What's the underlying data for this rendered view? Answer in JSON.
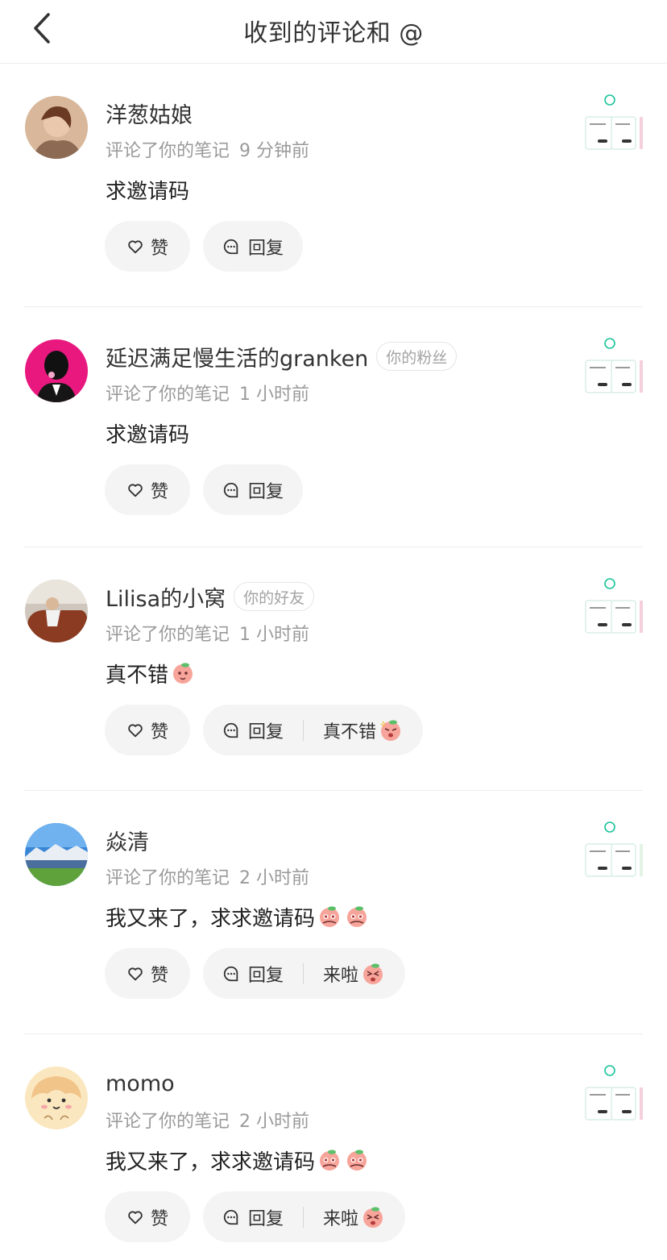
{
  "header": {
    "title": "收到的评论和 @"
  },
  "notifications": [
    {
      "name": "洋葱姑娘",
      "tag": "",
      "action": "评论了你的笔记",
      "time": "9 分钟前",
      "comment": "求邀请码",
      "comment_emojis": [],
      "like_label": "赞",
      "reply_label": "回复",
      "quick_reply": "",
      "quick_reply_emoji": ""
    },
    {
      "name": "延迟满足慢生活的granken",
      "tag": "你的粉丝",
      "action": "评论了你的笔记",
      "time": "1 小时前",
      "comment": "求邀请码",
      "comment_emojis": [],
      "like_label": "赞",
      "reply_label": "回复",
      "quick_reply": "",
      "quick_reply_emoji": ""
    },
    {
      "name": "Lilisa的小窝",
      "tag": "你的好友",
      "action": "评论了你的笔记",
      "time": "1 小时前",
      "comment": "真不错",
      "comment_emojis": [
        "peach-emoji"
      ],
      "like_label": "赞",
      "reply_label": "回复",
      "quick_reply": "真不错",
      "quick_reply_emoji": "peach-emoji"
    },
    {
      "name": "焱清",
      "tag": "",
      "action": "评论了你的笔记",
      "time": "2 小时前",
      "comment": "我又来了，求求邀请码",
      "comment_emojis": [
        "peach-emoji",
        "peach-emoji"
      ],
      "like_label": "赞",
      "reply_label": "回复",
      "quick_reply": "来啦",
      "quick_reply_emoji": "peach-emoji"
    },
    {
      "name": "momo",
      "tag": "",
      "action": "评论了你的笔记",
      "time": "2 小时前",
      "comment": "我又来了，求求邀请码",
      "comment_emojis": [
        "peach-emoji",
        "peach-emoji"
      ],
      "like_label": "赞",
      "reply_label": "回复",
      "quick_reply": "来啦",
      "quick_reply_emoji": "peach-emoji"
    }
  ],
  "colors": {
    "text": "#222222",
    "secondary": "#9a9a9a",
    "pill_bg": "#f4f4f5",
    "divider": "#ececec",
    "accent_pink": "#e8187f"
  }
}
